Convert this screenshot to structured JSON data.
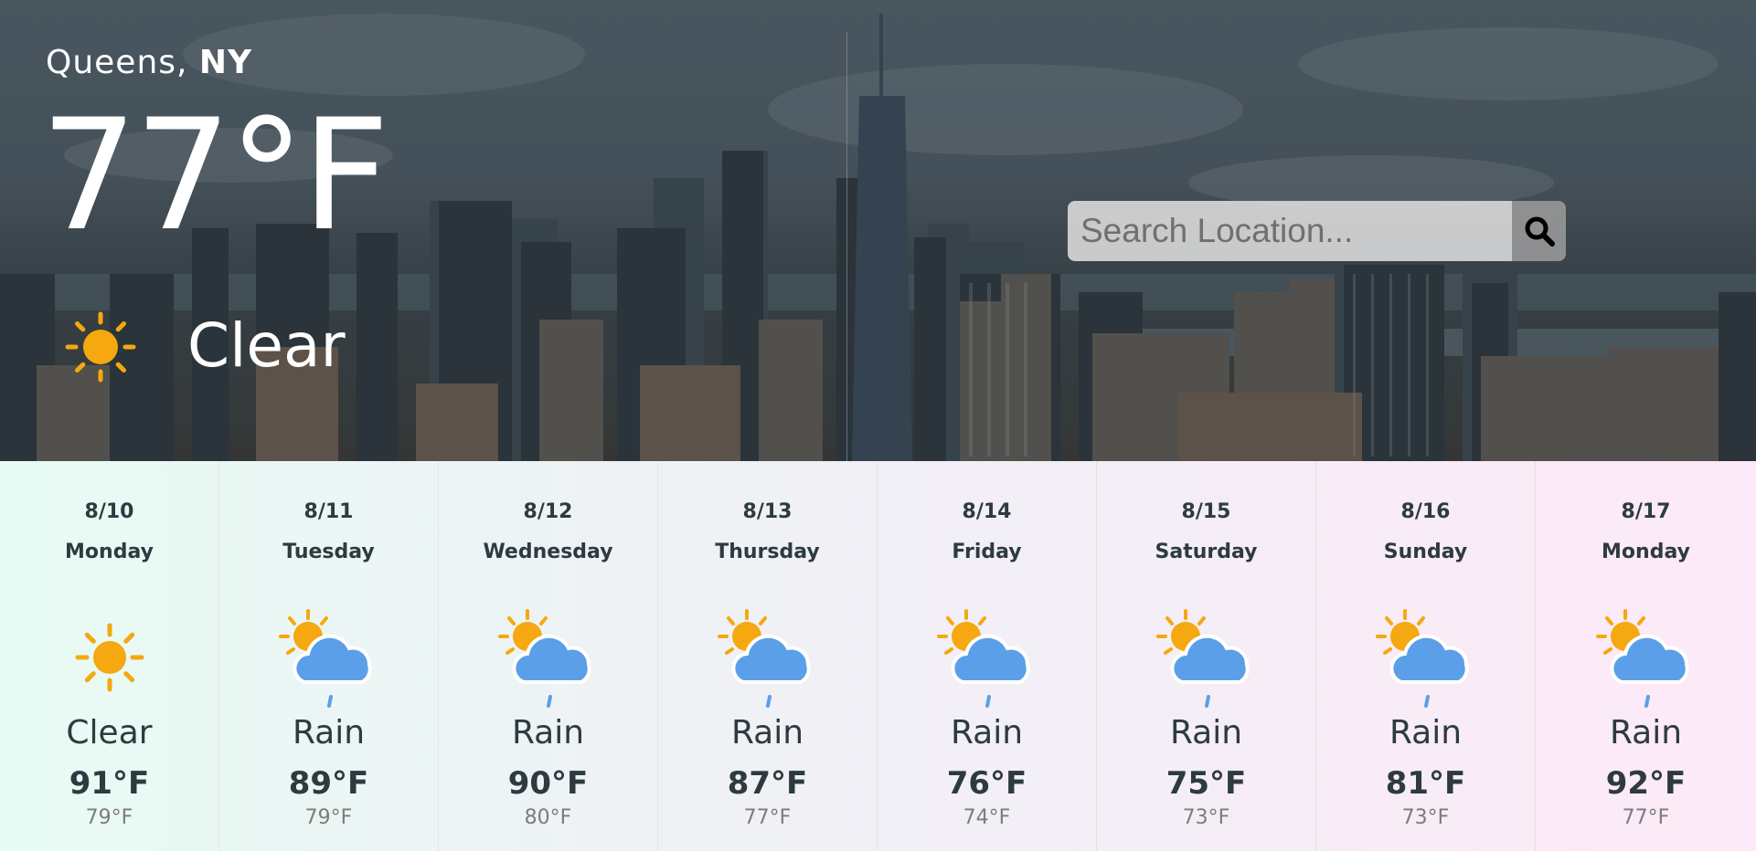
{
  "hero": {
    "location": {
      "city": "Queens,",
      "state": "NY"
    },
    "current": {
      "temperature": "77°F",
      "condition": "Clear",
      "icon": "sun-icon"
    }
  },
  "search": {
    "placeholder": "Search Location...",
    "value": "",
    "button_icon": "search-icon"
  },
  "forecast": [
    {
      "date": "8/10",
      "day": "Monday",
      "condition": "Clear",
      "high": "91°F",
      "low": "79°F",
      "icon": "sun-icon"
    },
    {
      "date": "8/11",
      "day": "Tuesday",
      "condition": "Rain",
      "high": "89°F",
      "low": "79°F",
      "icon": "sun-cloud-rain-icon"
    },
    {
      "date": "8/12",
      "day": "Wednesday",
      "condition": "Rain",
      "high": "90°F",
      "low": "80°F",
      "icon": "sun-cloud-rain-icon"
    },
    {
      "date": "8/13",
      "day": "Thursday",
      "condition": "Rain",
      "high": "87°F",
      "low": "77°F",
      "icon": "sun-cloud-rain-icon"
    },
    {
      "date": "8/14",
      "day": "Friday",
      "condition": "Rain",
      "high": "76°F",
      "low": "74°F",
      "icon": "sun-cloud-rain-icon"
    },
    {
      "date": "8/15",
      "day": "Saturday",
      "condition": "Rain",
      "high": "75°F",
      "low": "73°F",
      "icon": "sun-cloud-rain-icon"
    },
    {
      "date": "8/16",
      "day": "Sunday",
      "condition": "Rain",
      "high": "81°F",
      "low": "73°F",
      "icon": "sun-cloud-rain-icon"
    },
    {
      "date": "8/17",
      "day": "Monday",
      "condition": "Rain",
      "high": "92°F",
      "low": "77°F",
      "icon": "sun-cloud-rain-icon"
    }
  ],
  "colors": {
    "sun": "#f5a80f",
    "cloud": "#5b9fe8",
    "text_dark": "#2d3b40",
    "text_muted": "#7c7c7c"
  }
}
